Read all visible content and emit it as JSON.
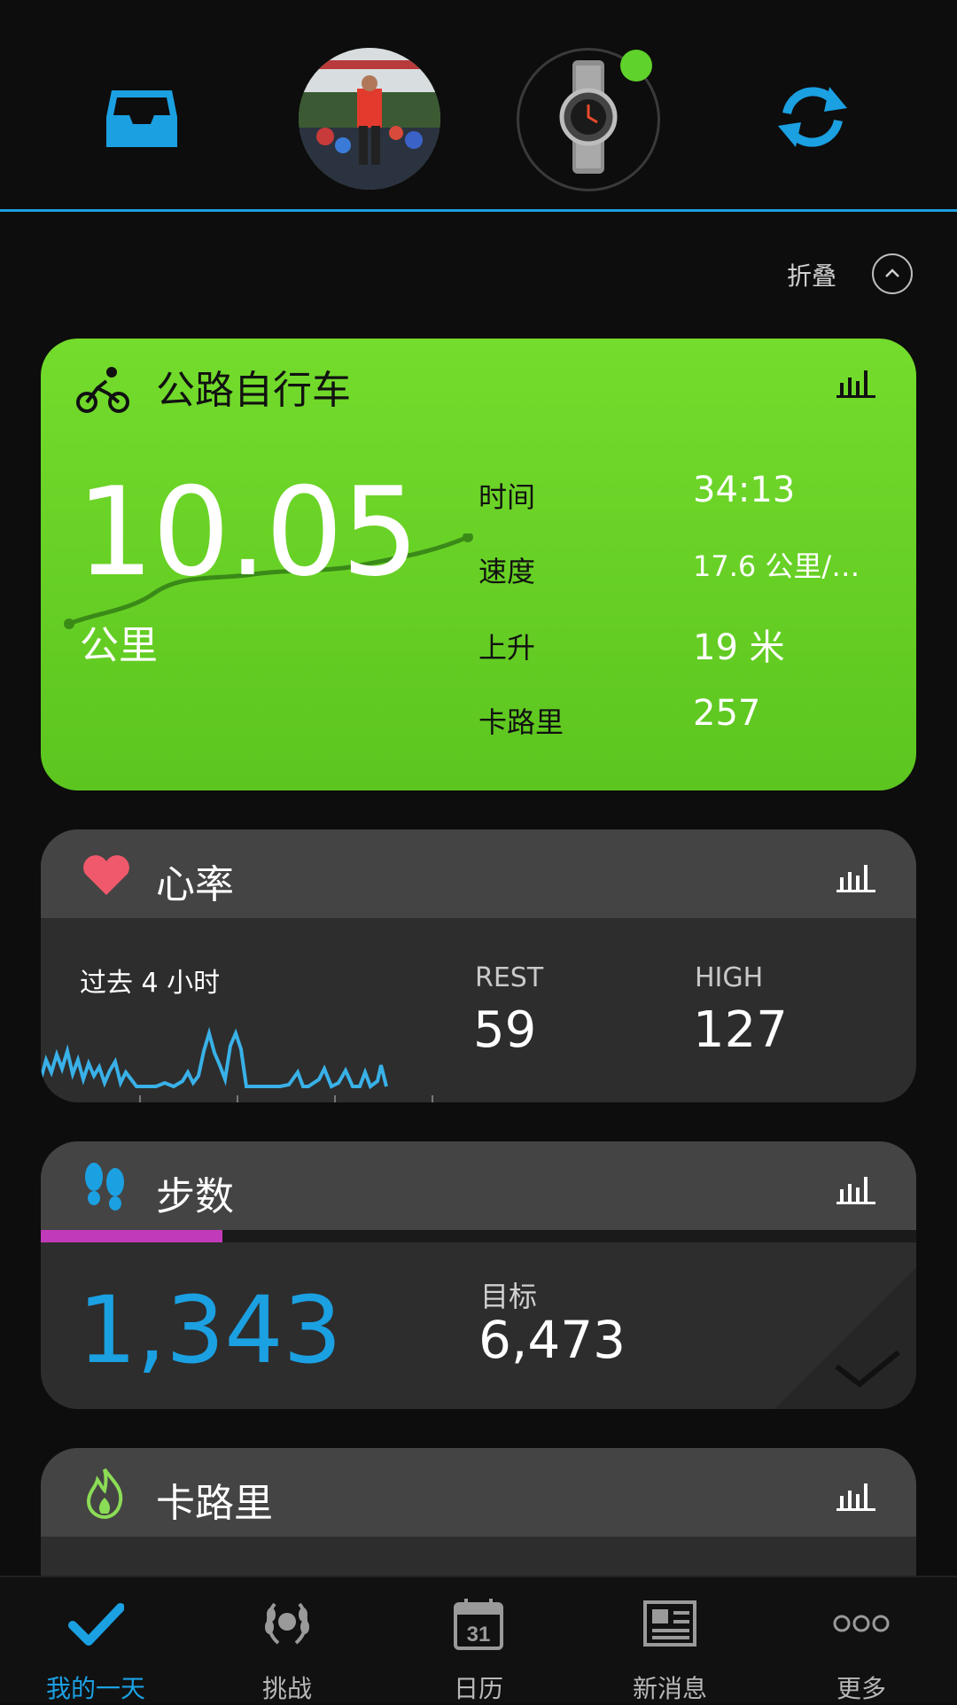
{
  "colors": {
    "accent": "#1ba0e2",
    "background": "#0d0d0d",
    "cycle_card": "#66d126",
    "heart": "#f0596b",
    "steps_progress": "#c13ab9",
    "online": "#5fd22b"
  },
  "header": {
    "inbox_icon": "inbox-icon",
    "avatar_alt": "profile-avatar",
    "watch_alt": "watch-device",
    "sync_icon": "sync-icon"
  },
  "collapse": {
    "label": "折叠"
  },
  "cycling": {
    "title": "公路自行车",
    "distance": "10.05",
    "distance_unit": "公里",
    "stats": [
      {
        "label": "时间",
        "value": "34:13"
      },
      {
        "label": "速度",
        "value": "17.6 公里/…"
      },
      {
        "label": "上升",
        "value": "19 米"
      },
      {
        "label": "卡路里",
        "value": "257"
      }
    ]
  },
  "heart_rate": {
    "title": "心率",
    "period": "过去 4 小时",
    "rest_label": "REST",
    "rest_value": "59",
    "high_label": "HIGH",
    "high_value": "127"
  },
  "steps": {
    "title": "步数",
    "value": "1,343",
    "goal_label": "目标",
    "goal_value": "6,473",
    "progress_fraction": 0.207
  },
  "calories": {
    "title": "卡路里"
  },
  "nav": [
    {
      "label": "我的一天",
      "icon": "checkmark-icon",
      "active": true
    },
    {
      "label": "挑战",
      "icon": "laurel-icon",
      "active": false
    },
    {
      "label": "日历",
      "icon": "calendar-icon",
      "active": false,
      "day": "31"
    },
    {
      "label": "新消息",
      "icon": "newspaper-icon",
      "active": false
    },
    {
      "label": "更多",
      "icon": "more-icon",
      "active": false
    }
  ]
}
